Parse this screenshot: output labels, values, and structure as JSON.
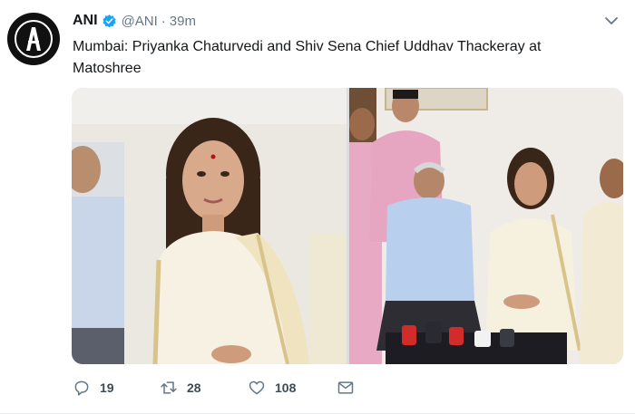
{
  "tweet": {
    "author_name": "ANI",
    "handle": "@ANI",
    "separator": "·",
    "time": "39m",
    "text": "Mumbai: Priyanka Chaturvedi and Shiv Sena Chief Uddhav Thackeray at Matoshree",
    "verified": true,
    "avatar_icon": "ani-logo-icon",
    "brand_color": "#1da1f2",
    "media": [
      {
        "kind": "photo",
        "subject": "woman-in-cream-saree-seated"
      },
      {
        "kind": "photo",
        "subject": "group-seated-at-press-conference"
      }
    ]
  },
  "actions": {
    "reply": {
      "icon": "reply-icon",
      "count": "19"
    },
    "retweet": {
      "icon": "retweet-icon",
      "count": "28"
    },
    "like": {
      "icon": "heart-icon",
      "count": "108"
    },
    "message": {
      "icon": "envelope-icon"
    }
  }
}
